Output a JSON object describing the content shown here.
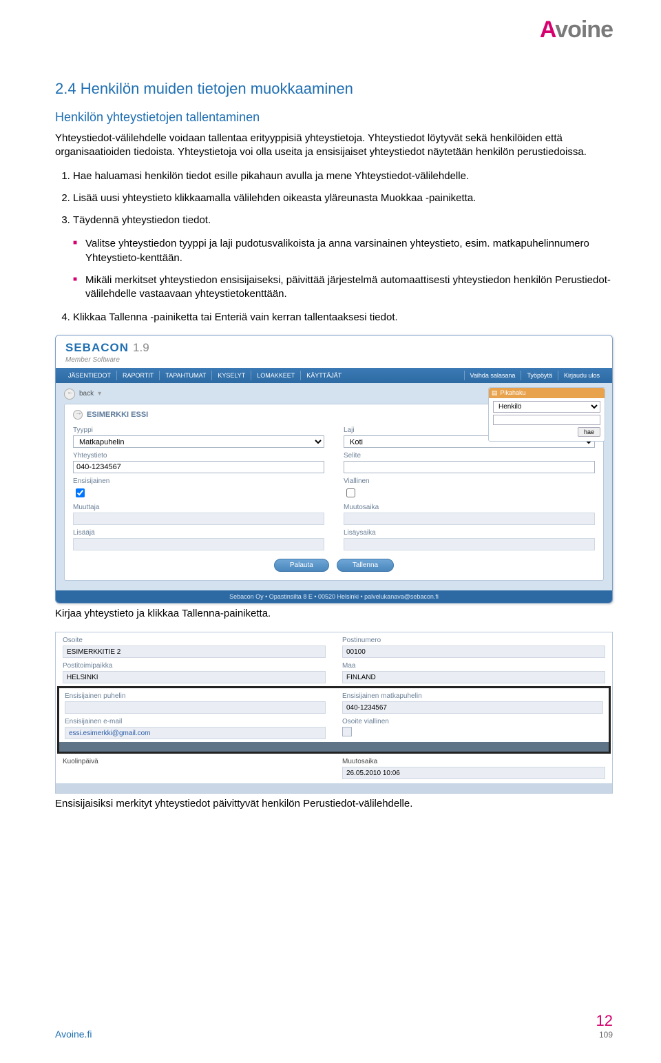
{
  "brand": {
    "full": "Avoine",
    "a": "A",
    "rest": "voine"
  },
  "section": {
    "number_title": "2.4  Henkilön muiden tietojen muokkaaminen",
    "subheading": "Henkilön yhteystietojen tallentaminen",
    "para1": "Yhteystiedot-välilehdelle voidaan tallentaa erityyppisiä yhteystietoja. Yhteystiedot löytyvät sekä henkilöiden että organisaatioiden tiedoista. Yhteystietoja voi olla useita ja ensisijaiset yhteystiedot näytetään henkilön perustiedoissa.",
    "steps_a": [
      "Hae haluamasi henkilön tiedot esille pikahaun avulla ja mene Yhteystiedot-välilehdelle.",
      "Lisää uusi yhteystieto klikkaamalla välilehden oikeasta yläreunasta Muokkaa -painiketta.",
      "Täydennä yhteystiedon tiedot."
    ],
    "bullets": [
      "Valitse yhteystiedon tyyppi ja laji pudotusvalikoista ja anna varsinainen yhteystieto, esim. matkapuhelinnumero Yhteystieto-kenttään.",
      "Mikäli merkitset yhteystiedon ensisijaiseksi, päivittää järjestelmä automaattisesti yhteystiedon henkilön Perustiedot-välilehdelle vastaavaan yhteystietokenttään."
    ],
    "steps_b": [
      "Klikkaa Tallenna -painiketta tai Enteriä vain kerran tallentaaksesi tiedot."
    ],
    "caption1": "Kirjaa yhteystieto ja klikkaa Tallenna-painiketta.",
    "caption2": "Ensisijaisiksi merkityt yhteystiedot päivittyvät henkilön Perustiedot-välilehdelle."
  },
  "shot1": {
    "app": {
      "name": "SEBACON",
      "ver": "1.9",
      "sub": "Member Software"
    },
    "menu": [
      "JÄSENTIEDOT",
      "RAPORTIT",
      "TAPAHTUMAT",
      "KYSELYT",
      "LOMAKKEET",
      "KÄYTTÄJÄT"
    ],
    "menu_right": [
      "Vaihda salasana",
      "Työpöytä",
      "Kirjaudu ulos"
    ],
    "back": "back",
    "pika": {
      "title": "Pikahaku",
      "sel": "Henkilö",
      "btn": "hae"
    },
    "person": "ESIMERKKI ESSI",
    "fields": {
      "tyyppi_l": "Tyyppi",
      "tyyppi_v": "Matkapuhelin",
      "laji_l": "Laji",
      "laji_v": "Koti",
      "yht_l": "Yhteystieto",
      "yht_v": "040-1234567",
      "selite_l": "Selite",
      "ens_l": "Ensisijainen",
      "ens_checked": true,
      "vial_l": "Viallinen",
      "vial_checked": false,
      "muuttaja_l": "Muuttaja",
      "muutosaika_l": "Muutosaika",
      "lisaaja_l": "Lisääjä",
      "lisaysaika_l": "Lisäysaika"
    },
    "btns": {
      "palauta": "Palauta",
      "tallenna": "Tallenna"
    },
    "footer": "Sebacon Oy • Opastinsilta 8 E • 00520 Helsinki • palvelukanava@sebacon.fi"
  },
  "shot2": {
    "osoite_l": "Osoite",
    "osoite_v": "ESIMERKKITIE 2",
    "postinro_l": "Postinumero",
    "postinro_v": "00100",
    "ptp_l": "Postitoimipaikka",
    "ptp_v": "HELSINKI",
    "maa_l": "Maa",
    "maa_v": "FINLAND",
    "ep_l": "Ensisijainen puhelin",
    "ep_v": "",
    "emp_l": "Ensisijainen matkapuhelin",
    "emp_v": "040-1234567",
    "email_l": "Ensisijainen e-mail",
    "email_v": "essi.esimerkki@gmail.com",
    "ov_l": "Osoite viallinen",
    "kp_l": "Kuolinpäivä",
    "ma_l": "Muutosaika",
    "ma_v": "26.05.2010 10:06"
  },
  "footer": {
    "site": "Avoine.fi",
    "page_big": "12",
    "page_small": "109"
  }
}
